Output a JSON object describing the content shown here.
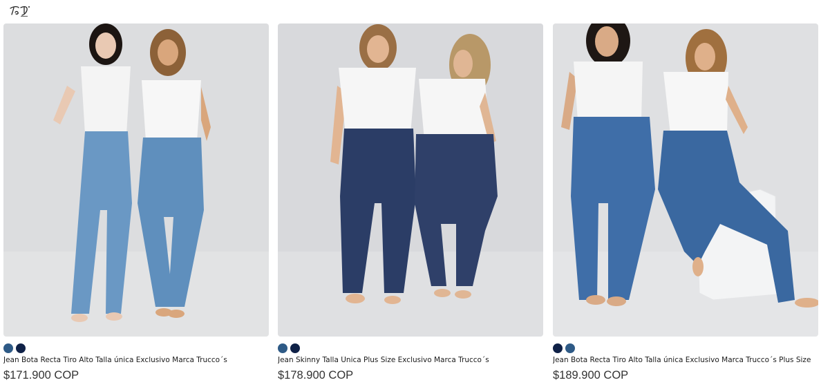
{
  "header": {
    "logo_icon": "trucco-script-logo-icon"
  },
  "products": [
    {
      "title": "Jean Bota Recta Tiro Alto Talla única Exclusivo Marca Trucco´s",
      "price": "$171.900 COP",
      "swatches": [
        {
          "color": "#2e5a86",
          "name": "medium-blue"
        },
        {
          "color": "#0f2147",
          "name": "dark-navy"
        }
      ],
      "image": {
        "background": "#dcdddf",
        "models": [
          {
            "hair": "#1c1512",
            "skin": "#e9c9b3",
            "top": "#f4f4f4",
            "jeans": "#6a98c4"
          },
          {
            "hair": "#8c6138",
            "skin": "#d9a67c",
            "top": "#f7f7f7",
            "jeans": "#5f8fbd"
          }
        ]
      }
    },
    {
      "title": "Jean Skinny Talla Única Plus Size Exclusivo Marca Trucco´s",
      "price": "$178.900 COP",
      "swatches": [
        {
          "color": "#2e5a86",
          "name": "medium-blue"
        },
        {
          "color": "#0f2147",
          "name": "dark-navy"
        }
      ],
      "image": {
        "background": "#d8d9dc",
        "models": [
          {
            "hair": "#9a6f45",
            "skin": "#e2b592",
            "top": "#f6f6f6",
            "jeans": "#2b3d66"
          },
          {
            "hair": "#b89868",
            "skin": "#e0b694",
            "top": "#f6f6f6",
            "jeans": "#2f4069"
          }
        ]
      }
    },
    {
      "title": "Jean Bota Recta Tiro Alto Talla única Exclusivo Marca Trucco´s Plus Size",
      "price": "$189.900 COP",
      "swatches": [
        {
          "color": "#0f2147",
          "name": "dark-navy"
        },
        {
          "color": "#2e5a86",
          "name": "medium-blue"
        }
      ],
      "image": {
        "background": "#dfe0e2",
        "models": [
          {
            "hair": "#1e1714",
            "skin": "#d9aa86",
            "top": "#f5f5f5",
            "jeans": "#3f6ea8"
          },
          {
            "hair": "#a0703f",
            "skin": "#dfb08a",
            "top": "#f7f7f7",
            "jeans": "#3a68a0"
          }
        ]
      }
    }
  ]
}
